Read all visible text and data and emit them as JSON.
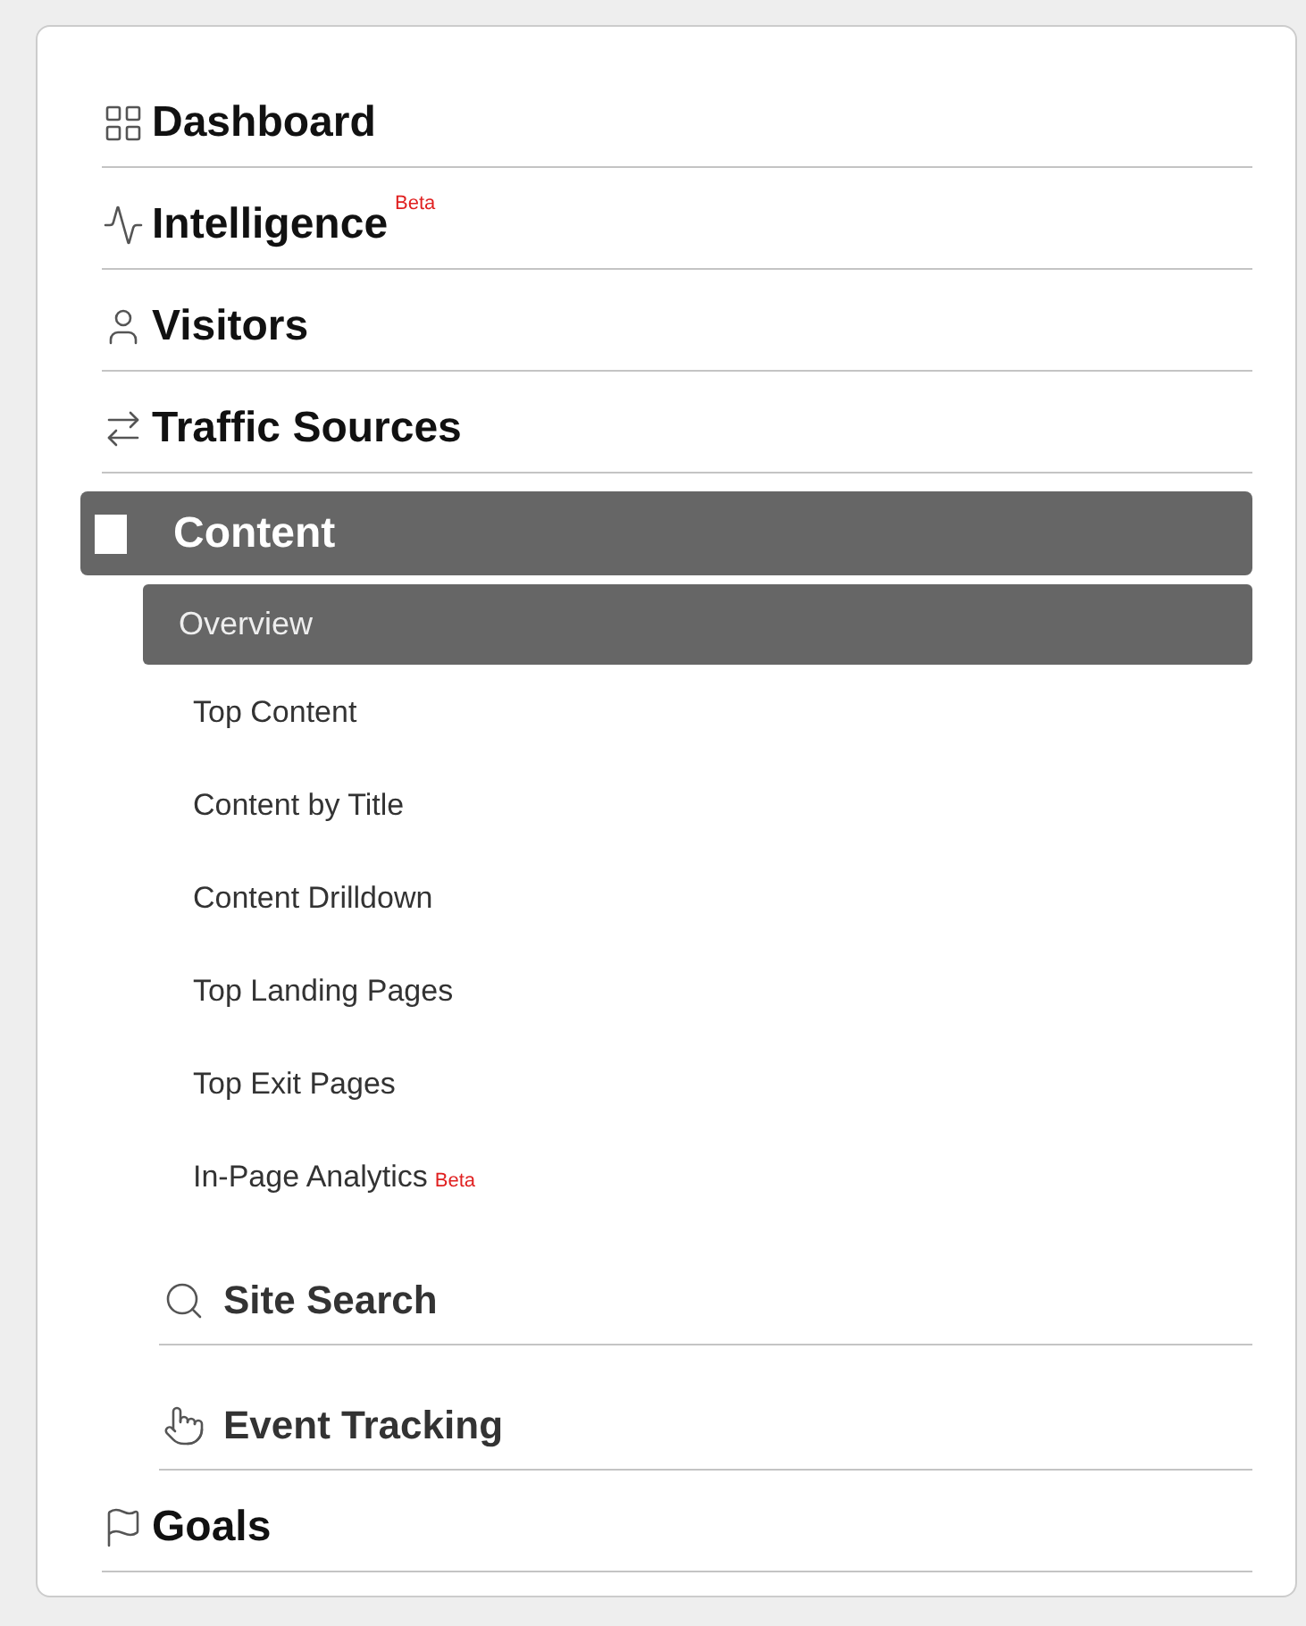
{
  "nav": {
    "items": [
      {
        "label": "Dashboard",
        "selected": false
      },
      {
        "label": "Intelligence",
        "badge": "Beta",
        "selected": false
      },
      {
        "label": "Visitors",
        "selected": false
      },
      {
        "label": "Traffic Sources",
        "selected": false
      },
      {
        "label": "Content",
        "selected": true,
        "children": [
          {
            "kind": "page",
            "label": "Overview",
            "selected": true
          },
          {
            "kind": "page",
            "label": "Top Content",
            "selected": false
          },
          {
            "kind": "page",
            "label": "Content by Title",
            "selected": false
          },
          {
            "kind": "page",
            "label": "Content Drilldown",
            "selected": false
          },
          {
            "kind": "page",
            "label": "Top Landing Pages",
            "selected": false
          },
          {
            "kind": "page",
            "label": "Top Exit Pages",
            "selected": false
          },
          {
            "kind": "page",
            "label": "In-Page Analytics",
            "badge": "Beta",
            "selected": false
          },
          {
            "kind": "group",
            "label": "Site Search",
            "selected": false
          },
          {
            "kind": "group",
            "label": "Event Tracking",
            "selected": false
          }
        ]
      },
      {
        "label": "Goals",
        "selected": false
      }
    ]
  }
}
